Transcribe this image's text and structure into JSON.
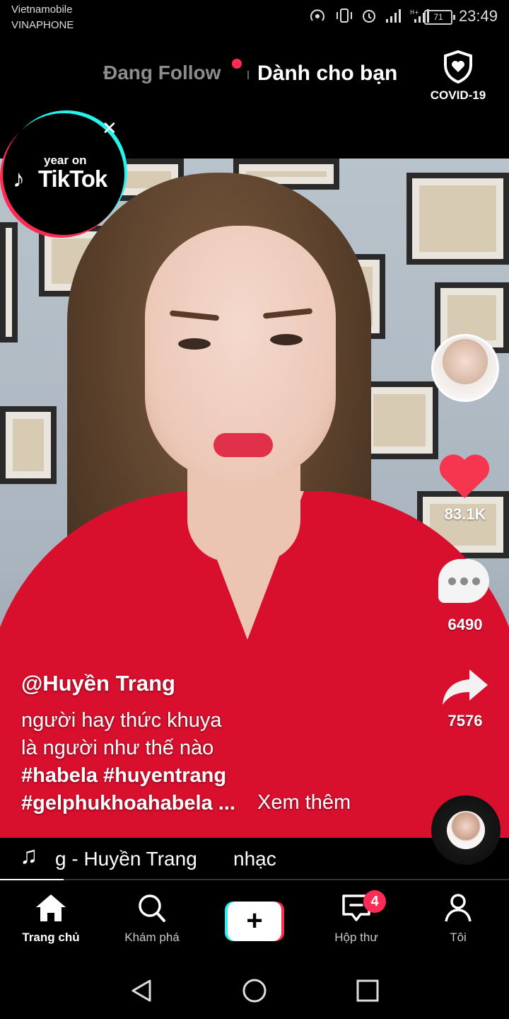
{
  "status_bar": {
    "carrier_1": "Vietnamobile",
    "carrier_2": "VINAPHONE",
    "battery": "71",
    "time": "23:49",
    "icons": [
      "hotspot-icon",
      "vibrate-icon",
      "alarm-icon",
      "signal-icon",
      "signal-icon"
    ]
  },
  "top_nav": {
    "following_label": "Đang Follow",
    "for_you_label": "Dành cho bạn",
    "covid_label": "COVID-19",
    "following_has_new": true
  },
  "promo_badge": {
    "line_1": "year on",
    "line_2": "TikTok"
  },
  "actions": {
    "likes": "83.1K",
    "comments": "6490",
    "shares": "7576"
  },
  "caption": {
    "author": "@Huyền Trang",
    "line_1": "người hay thức khuya",
    "line_2": "là người như thế nào",
    "hashtags_1": "#habela #huyentrang",
    "hashtags_2": "#gelphukhoahabela ...",
    "see_more": "Xem thêm"
  },
  "music": {
    "text_1": "ɡ - Huyền Trang",
    "text_2": "nhạc"
  },
  "video_progress": 0.125,
  "bottom_nav": {
    "home": "Trang chủ",
    "discover": "Khám phá",
    "inbox": "Hộp thư",
    "inbox_badge": "4",
    "profile": "Tôi"
  },
  "colors": {
    "accent_red": "#fe2c55",
    "accent_cyan": "#25f4ee",
    "like_red": "#f5364e"
  }
}
